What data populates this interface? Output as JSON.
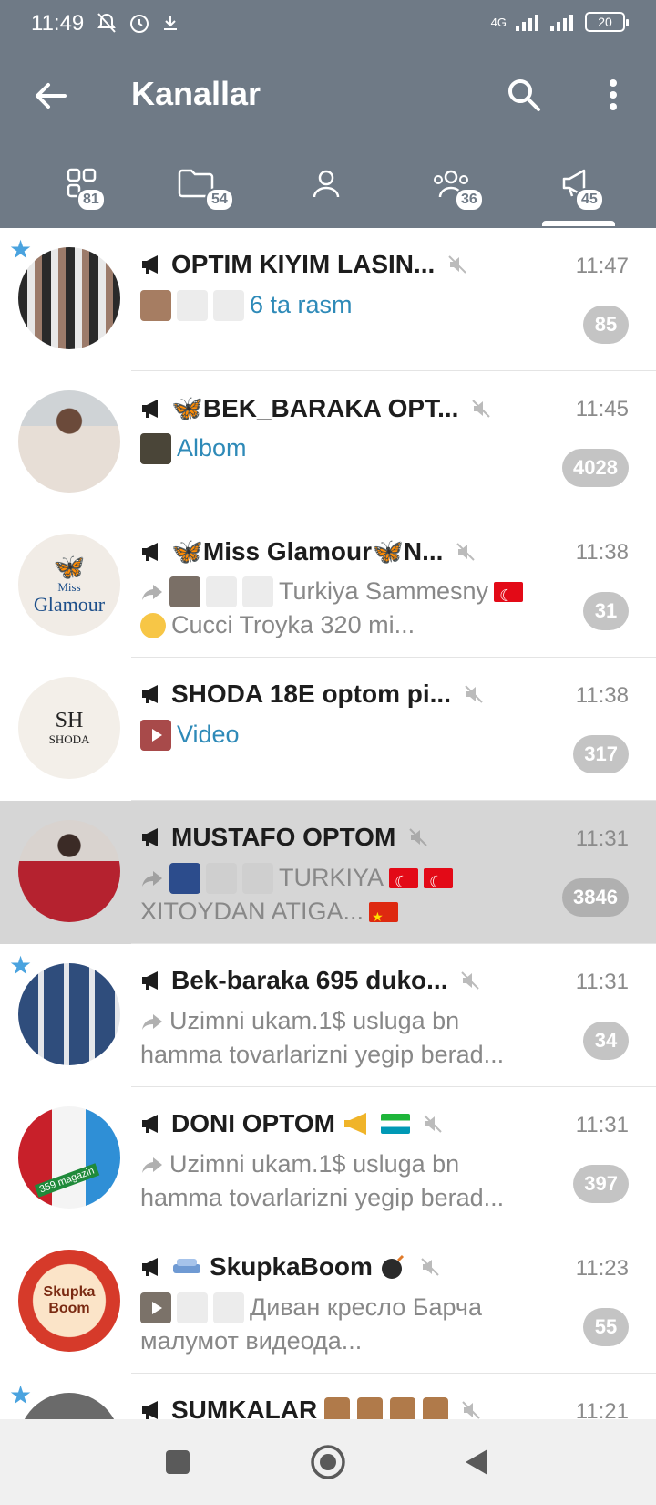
{
  "status": {
    "time": "11:49",
    "network": "4G",
    "battery": "20"
  },
  "toolbar": {
    "title": "Kanallar",
    "back_icon": "arrow-left-icon",
    "search_icon": "search-icon",
    "menu_icon": "more-vertical-icon"
  },
  "tabs": [
    {
      "icon": "all-chats-icon",
      "count": "81"
    },
    {
      "icon": "folder-icon",
      "count": "54"
    },
    {
      "icon": "user-icon",
      "count": ""
    },
    {
      "icon": "groups-icon",
      "count": "36"
    },
    {
      "icon": "channels-icon",
      "count": "45"
    }
  ],
  "chats": [
    {
      "name": "OPTIM KIYIM LASIN...",
      "time": "11:47",
      "line1": "6 ta rasm",
      "line2": "",
      "count": "85",
      "starred": true
    },
    {
      "name": "🦋BEK_BARAKA OPT...",
      "time": "11:45",
      "line1": "Albom",
      "line2": "",
      "count": "4028",
      "starred": false
    },
    {
      "name": "🦋Miss Glamour🦋N...",
      "time": "11:38",
      "line1": "Turkiya Sammesny",
      "line2": "Cucci Troyka 320 mi...",
      "count": "31",
      "starred": false
    },
    {
      "name": "SHODA 18E optom pi...",
      "time": "11:38",
      "line1": "Video",
      "line2": "",
      "count": "317",
      "starred": false
    },
    {
      "name": "MUSTAFO OPTOM",
      "time": "11:31",
      "line1": "TURKIYA",
      "line2": "XITOYDAN ATIGA...",
      "count": "3846",
      "starred": false
    },
    {
      "name": "Bek-baraka 695 duko...",
      "time": "11:31",
      "line1": "Uzimni ukam.1$ usluga bn",
      "line2": "hamma tovarlarizni yegip berad...",
      "count": "34",
      "starred": true
    },
    {
      "name": "DONI OPTOM",
      "time": "11:31",
      "line1": "Uzimni ukam.1$ usluga bn",
      "line2": "hamma tovarlarizni yegip berad...",
      "count": "397",
      "starred": false
    },
    {
      "name": "SkupkaBoom",
      "time": "11:23",
      "line1": "Диван кресло Барча",
      "line2": "малумот видеода...",
      "count": "55",
      "starred": false
    },
    {
      "name": "SUMKALAR",
      "time": "11:21",
      "line1": "",
      "line2": "",
      "count": "",
      "starred": true
    }
  ],
  "avatars": {
    "miss_glamour_top": "Miss",
    "miss_glamour_bottom": "Glamour",
    "shoda_mark": "SH",
    "shoda_text": "SHODA",
    "skupka_top": "Skupka",
    "skupka_bottom": "Boom",
    "doni_tag": "359 magazin"
  },
  "nav": {
    "recent_icon": "square-icon",
    "home_icon": "circle-home-icon",
    "back_icon": "triangle-back-icon"
  }
}
